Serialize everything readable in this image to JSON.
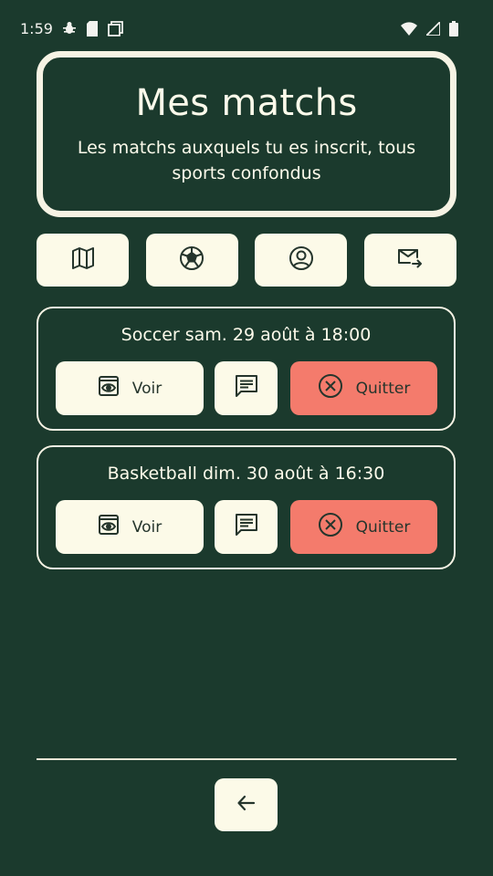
{
  "status_bar": {
    "time": "1:59",
    "icons": [
      "bug-icon",
      "sd-card-icon",
      "screenshot-icon",
      "wifi-icon",
      "signal-icon",
      "battery-icon"
    ]
  },
  "header": {
    "title": "Mes matchs",
    "subtitle": "Les matchs auxquels tu es inscrit, tous sports confondus"
  },
  "nav": {
    "items": [
      {
        "icon": "map-icon"
      },
      {
        "icon": "soccer-ball-icon"
      },
      {
        "icon": "profile-icon"
      },
      {
        "icon": "mail-forward-icon"
      }
    ]
  },
  "matches": [
    {
      "title": "Soccer sam. 29 août à 18:00",
      "view_label": "Voir",
      "quit_label": "Quitter"
    },
    {
      "title": "Basketball dim. 30 août à 16:30",
      "view_label": "Voir",
      "quit_label": "Quitter"
    }
  ],
  "colors": {
    "background": "#1b3a2d",
    "card_border": "#f6f3e4",
    "button_light": "#fcfae8",
    "button_danger": "#f47b6c",
    "icon_dark": "#25352c"
  }
}
